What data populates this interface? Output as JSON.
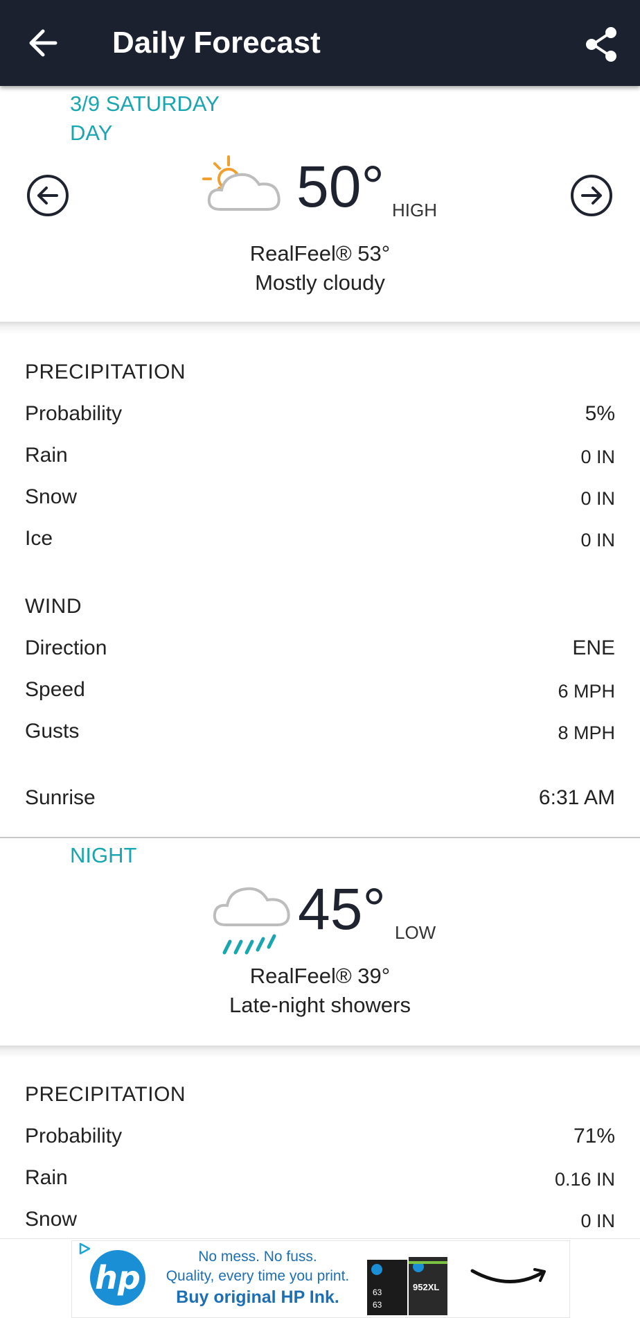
{
  "appbar": {
    "title": "Daily Forecast"
  },
  "day": {
    "date_label": "3/9 SATURDAY",
    "period_label": "DAY",
    "temperature": "50°",
    "temp_kind": "HIGH",
    "realfeel": "RealFeel® 53°",
    "condition": "Mostly cloudy",
    "icon": "partly-cloudy-sun-icon",
    "precipitation": {
      "heading": "PRECIPITATION",
      "rows": [
        {
          "label": "Probability",
          "value": "5%"
        },
        {
          "label": "Rain",
          "value": "0 IN"
        },
        {
          "label": "Snow",
          "value": "0 IN"
        },
        {
          "label": "Ice",
          "value": "0 IN"
        }
      ]
    },
    "wind": {
      "heading": "WIND",
      "rows": [
        {
          "label": "Direction",
          "value": "ENE"
        },
        {
          "label": "Speed",
          "value": "6 MPH"
        },
        {
          "label": "Gusts",
          "value": "8 MPH"
        }
      ]
    },
    "sunrise": {
      "label": "Sunrise",
      "value": "6:31 AM"
    }
  },
  "night": {
    "period_label": "NIGHT",
    "temperature": "45°",
    "temp_kind": "LOW",
    "realfeel": "RealFeel® 39°",
    "condition": "Late-night showers",
    "icon": "rain-cloud-icon",
    "precipitation": {
      "heading": "PRECIPITATION",
      "rows": [
        {
          "label": "Probability",
          "value": "71%"
        },
        {
          "label": "Rain",
          "value": "0.16 IN"
        },
        {
          "label": "Snow",
          "value": "0 IN"
        }
      ]
    }
  },
  "ad": {
    "brand": "hp",
    "line1": "No mess. No fuss.",
    "line2": "Quality, every time you print.",
    "line3": "Buy original HP Ink.",
    "ink_labels": [
      "63",
      "63",
      "952XL"
    ]
  },
  "colors": {
    "appbar": "#1c2130",
    "accent": "#1aa6b0",
    "sun": "#f0a030",
    "hp_blue": "#1a8fd6"
  }
}
